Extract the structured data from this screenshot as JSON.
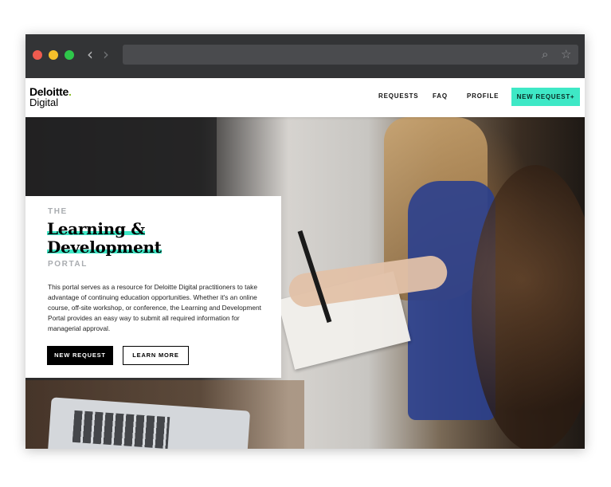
{
  "browser": {
    "back_icon": "‹",
    "forward_icon": "›",
    "search_icon": "⌕",
    "star_icon": "☆"
  },
  "site": {
    "logo_line1": "Deloitte",
    "logo_dot": ".",
    "logo_line2": "Digital",
    "nav": {
      "requests": "REQUESTS",
      "faq": "FAQ",
      "profile": "PROFILE",
      "new_request": "NEW REQUEST+"
    },
    "colors": {
      "accent": "#3ee8c6",
      "brand_green": "#86bc25"
    }
  },
  "hero": {
    "pre_title": "THE",
    "title_line1": "Learning &",
    "title_line2": "Development",
    "post_title": "PORTAL",
    "description": "This portal serves as a resource for Deloitte Digital practitioners to take advantage of continuing education opportunities. Whether it's an online course, off-site workshop, or conference, the Learning and Development Portal provides an easy way to submit all required information for managerial approval.",
    "primary_button": "NEW REQUEST",
    "secondary_button": "LEARN MORE"
  }
}
